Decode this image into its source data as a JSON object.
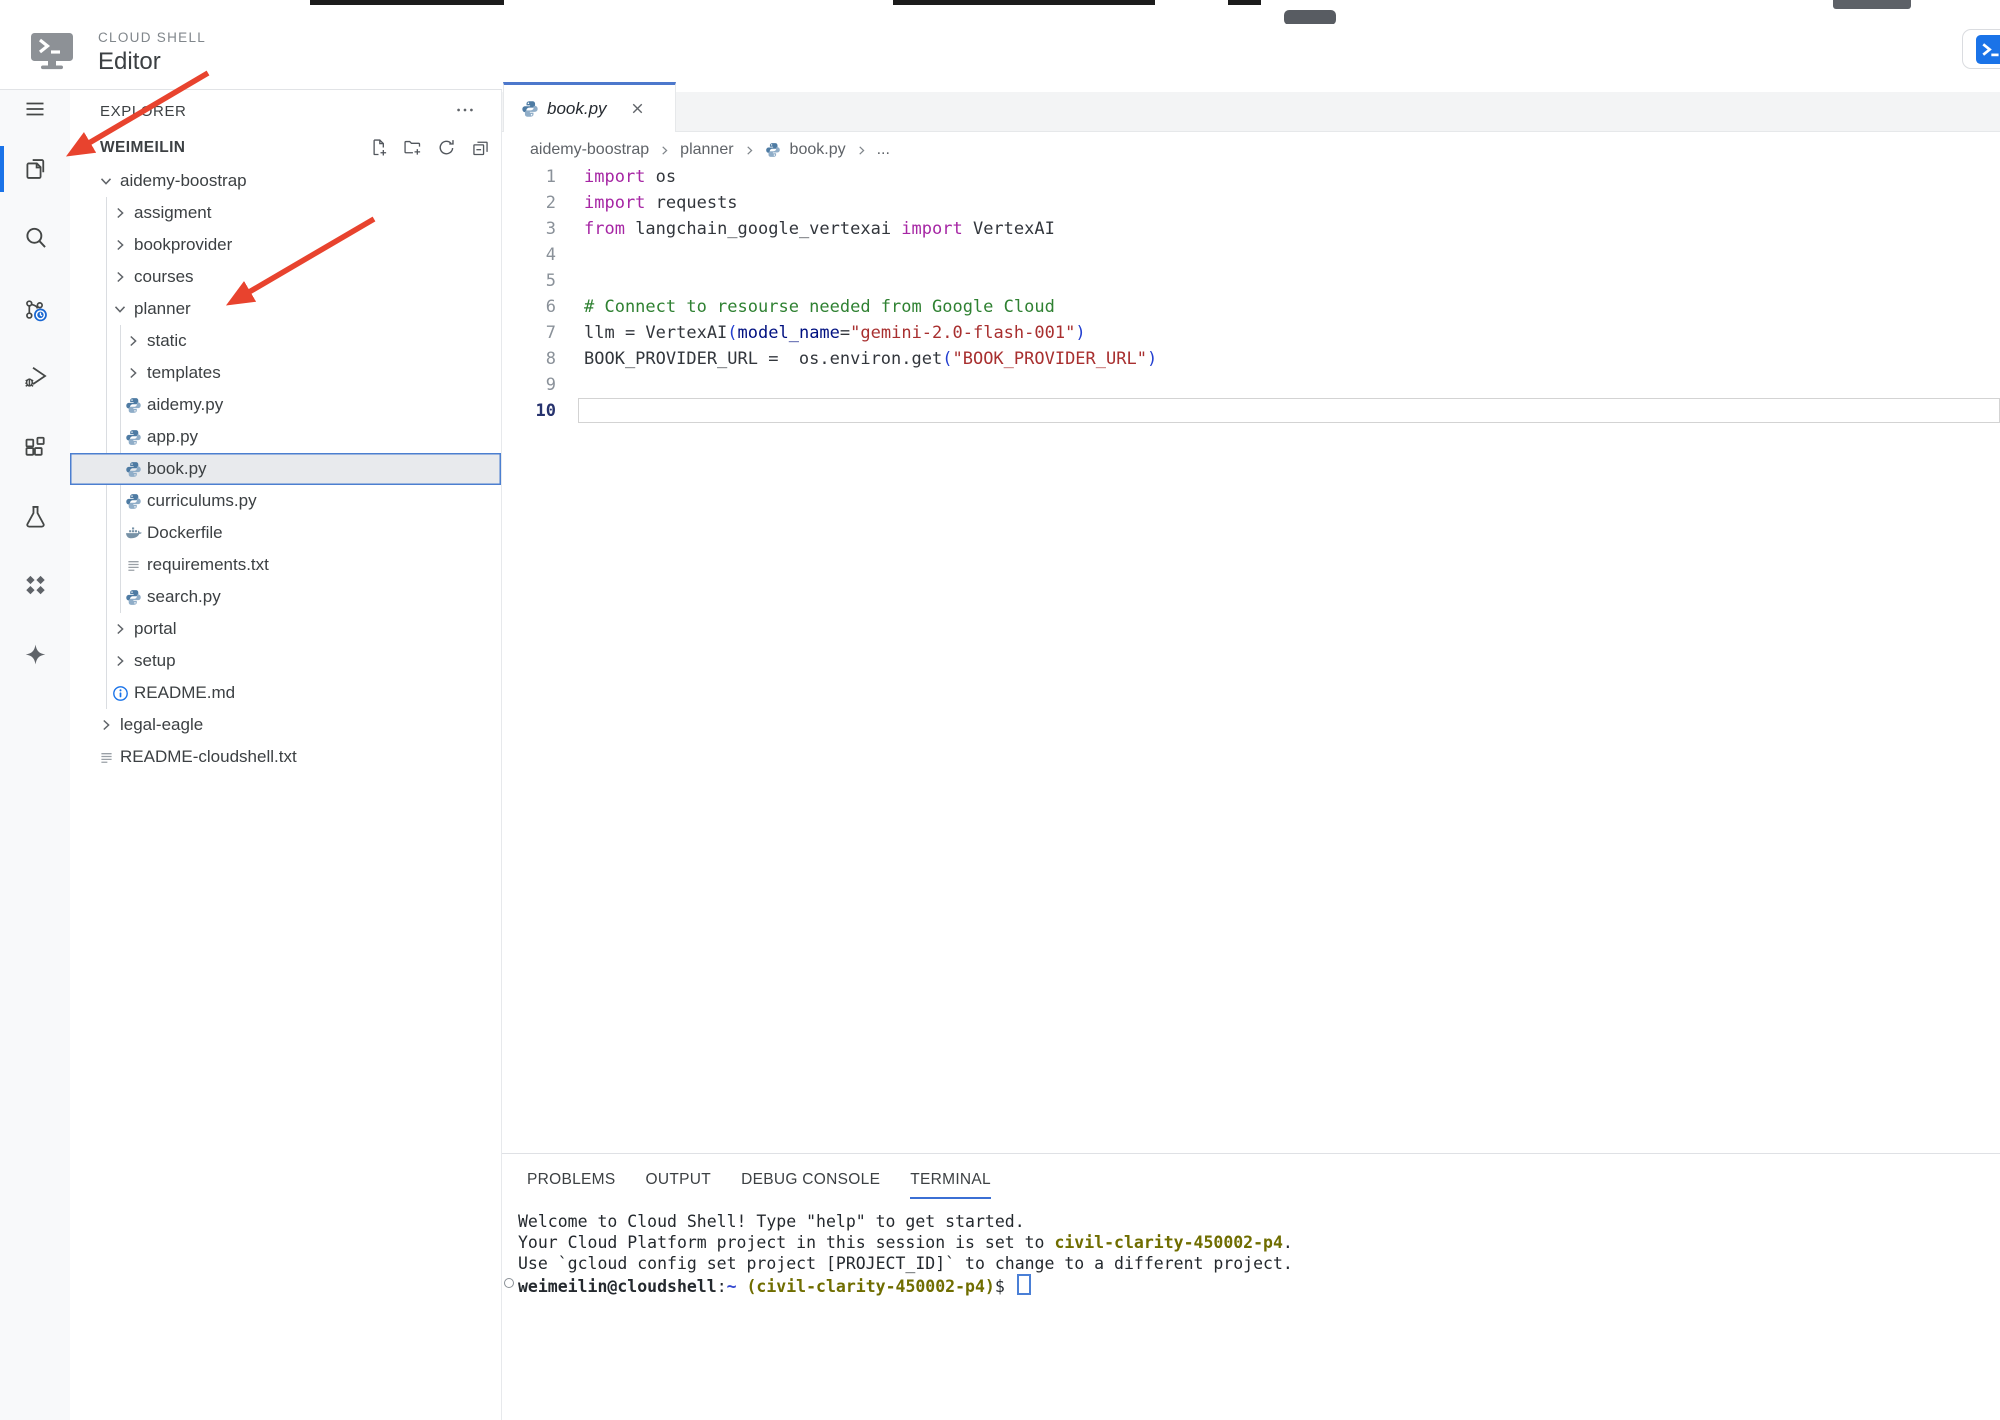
{
  "header": {
    "product_label": "CLOUD SHELL",
    "title": "Editor",
    "logo_icon": "cloud-shell-logo",
    "open_terminal_icon": "terminal-blue"
  },
  "activity_bar": {
    "items": [
      {
        "id": "menu",
        "icon": "hamburger-menu",
        "active": false
      },
      {
        "id": "explorer",
        "icon": "files",
        "active": true
      },
      {
        "id": "search",
        "icon": "search",
        "active": false
      },
      {
        "id": "source-control",
        "icon": "source-control-clock",
        "active": false
      },
      {
        "id": "run-debug",
        "icon": "debug",
        "active": false
      },
      {
        "id": "extensions",
        "icon": "extensions",
        "active": false
      },
      {
        "id": "testing",
        "icon": "flask",
        "active": false
      },
      {
        "id": "cloud-code",
        "icon": "four-diamonds",
        "active": false
      },
      {
        "id": "gemini",
        "icon": "sparkle",
        "active": false
      }
    ]
  },
  "explorer": {
    "title": "EXPLORER",
    "more_icon": "ellipsis",
    "workspace_label": "WEIMEILIN",
    "workspace_actions": [
      {
        "id": "new-file",
        "icon": "new-file"
      },
      {
        "id": "new-folder",
        "icon": "new-folder"
      },
      {
        "id": "refresh",
        "icon": "refresh"
      },
      {
        "id": "collapse-all",
        "icon": "collapse-all"
      }
    ],
    "tree": [
      {
        "label": "aidemy-boostrap",
        "type": "folder",
        "expanded": true,
        "level": 1
      },
      {
        "label": "assigment",
        "type": "folder",
        "expanded": false,
        "level": 2
      },
      {
        "label": "bookprovider",
        "type": "folder",
        "expanded": false,
        "level": 2
      },
      {
        "label": "courses",
        "type": "folder",
        "expanded": false,
        "level": 2
      },
      {
        "label": "planner",
        "type": "folder",
        "expanded": true,
        "level": 2
      },
      {
        "label": "static",
        "type": "folder",
        "expanded": false,
        "level": 3
      },
      {
        "label": "templates",
        "type": "folder",
        "expanded": false,
        "level": 3
      },
      {
        "label": "aidemy.py",
        "type": "python",
        "level": 3
      },
      {
        "label": "app.py",
        "type": "python",
        "level": 3
      },
      {
        "label": "book.py",
        "type": "python",
        "level": 3,
        "selected": true
      },
      {
        "label": "curriculums.py",
        "type": "python",
        "level": 3
      },
      {
        "label": "Dockerfile",
        "type": "docker",
        "level": 3
      },
      {
        "label": "requirements.txt",
        "type": "text",
        "level": 3
      },
      {
        "label": "search.py",
        "type": "python",
        "level": 3
      },
      {
        "label": "portal",
        "type": "folder",
        "expanded": false,
        "level": 2
      },
      {
        "label": "setup",
        "type": "folder",
        "expanded": false,
        "level": 2
      },
      {
        "label": "README.md",
        "type": "info",
        "level": 2
      },
      {
        "label": "legal-eagle",
        "type": "folder",
        "expanded": false,
        "level": 1
      },
      {
        "label": "README-cloudshell.txt",
        "type": "text",
        "level": 1
      }
    ]
  },
  "editor": {
    "tab": {
      "label": "book.py",
      "icon": "python",
      "close_icon": "close"
    },
    "breadcrumb": {
      "items": [
        "aidemy-boostrap",
        "planner",
        "book.py",
        "..."
      ],
      "file_icon": "python"
    },
    "code": {
      "lines": [
        {
          "n": 1,
          "tokens": [
            [
              "kw",
              "import"
            ],
            [
              "pl",
              " os"
            ]
          ]
        },
        {
          "n": 2,
          "tokens": [
            [
              "kw",
              "import"
            ],
            [
              "pl",
              " requests"
            ]
          ]
        },
        {
          "n": 3,
          "tokens": [
            [
              "kw",
              "from"
            ],
            [
              "pl",
              " langchain_google_vertexai "
            ],
            [
              "kw",
              "import"
            ],
            [
              "pl",
              " VertexAI"
            ]
          ]
        },
        {
          "n": 4,
          "tokens": []
        },
        {
          "n": 5,
          "tokens": []
        },
        {
          "n": 6,
          "tokens": [
            [
              "cm",
              "# Connect to resourse needed from Google Cloud"
            ]
          ]
        },
        {
          "n": 7,
          "tokens": [
            [
              "pl",
              "llm = VertexAI"
            ],
            [
              "pn",
              "("
            ],
            [
              "prop",
              "model_name"
            ],
            [
              "pl",
              "="
            ],
            [
              "str",
              "\"gemini-2.0-flash-001\""
            ],
            [
              "pn",
              ")"
            ]
          ]
        },
        {
          "n": 8,
          "tokens": [
            [
              "pl",
              "BOOK_PROVIDER_URL =  os.environ.get"
            ],
            [
              "pn",
              "("
            ],
            [
              "str",
              "\"BOOK_PROVIDER_URL\""
            ],
            [
              "pn",
              ")"
            ]
          ]
        },
        {
          "n": 9,
          "tokens": []
        },
        {
          "n": 10,
          "tokens": [],
          "current": true
        }
      ]
    }
  },
  "panel": {
    "tabs": [
      {
        "label": "PROBLEMS",
        "active": false
      },
      {
        "label": "OUTPUT",
        "active": false
      },
      {
        "label": "DEBUG CONSOLE",
        "active": false
      },
      {
        "label": "TERMINAL",
        "active": true
      }
    ],
    "terminal": {
      "lines": [
        {
          "segments": [
            [
              "plain",
              "Welcome to Cloud Shell! Type \"help\" to get started."
            ]
          ]
        },
        {
          "segments": [
            [
              "plain",
              "Your Cloud Platform project in this session is set to "
            ],
            [
              "project",
              "civil-clarity-450002-p4"
            ],
            [
              "plain",
              "."
            ]
          ]
        },
        {
          "segments": [
            [
              "plain",
              "Use `gcloud config set project [PROJECT_ID]` to change to a different project."
            ]
          ]
        },
        {
          "prompt": true,
          "segments": [
            [
              "user",
              "weimeilin@cloudshell"
            ],
            [
              "plain",
              ":"
            ],
            [
              "path",
              "~"
            ],
            [
              "plain",
              " "
            ],
            [
              "project",
              "(civil-clarity-450002-p4)"
            ],
            [
              "plain",
              "$ "
            ],
            [
              "cursor",
              ""
            ]
          ]
        }
      ]
    }
  },
  "colors": {
    "accent_blue": "#1a73e8",
    "tab_accent": "#4d78cc",
    "selection_border": "#4c7fd0",
    "arrow_red": "#e8432e",
    "keyword": "#a626a4",
    "comment": "#2f8132",
    "string": "#a82f2f",
    "project_olive": "#6f6d00"
  }
}
